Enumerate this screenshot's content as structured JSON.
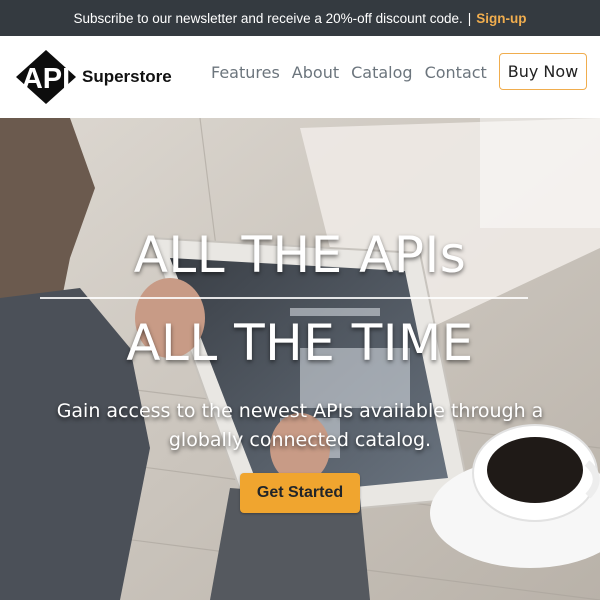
{
  "banner": {
    "text": "Subscribe to our newsletter and receive a 20%-off discount code.",
    "separator": "|",
    "link_label": "Sign-up"
  },
  "navbar": {
    "logo_text": "API",
    "brand_name": "Superstore",
    "links": [
      "Features",
      "About",
      "Catalog",
      "Contact"
    ],
    "buy_label": "Buy Now"
  },
  "hero": {
    "title_line1": "ALL THE APIs",
    "title_line2": "ALL THE TIME",
    "subtitle": "Gain access to the newest APIs available through a globally connected catalog.",
    "cta_label": "Get Started"
  },
  "colors": {
    "banner_bg": "#343a40",
    "accent": "#f0ad4e",
    "cta_bg": "#f0a52f",
    "nav_link": "#6c757d"
  }
}
